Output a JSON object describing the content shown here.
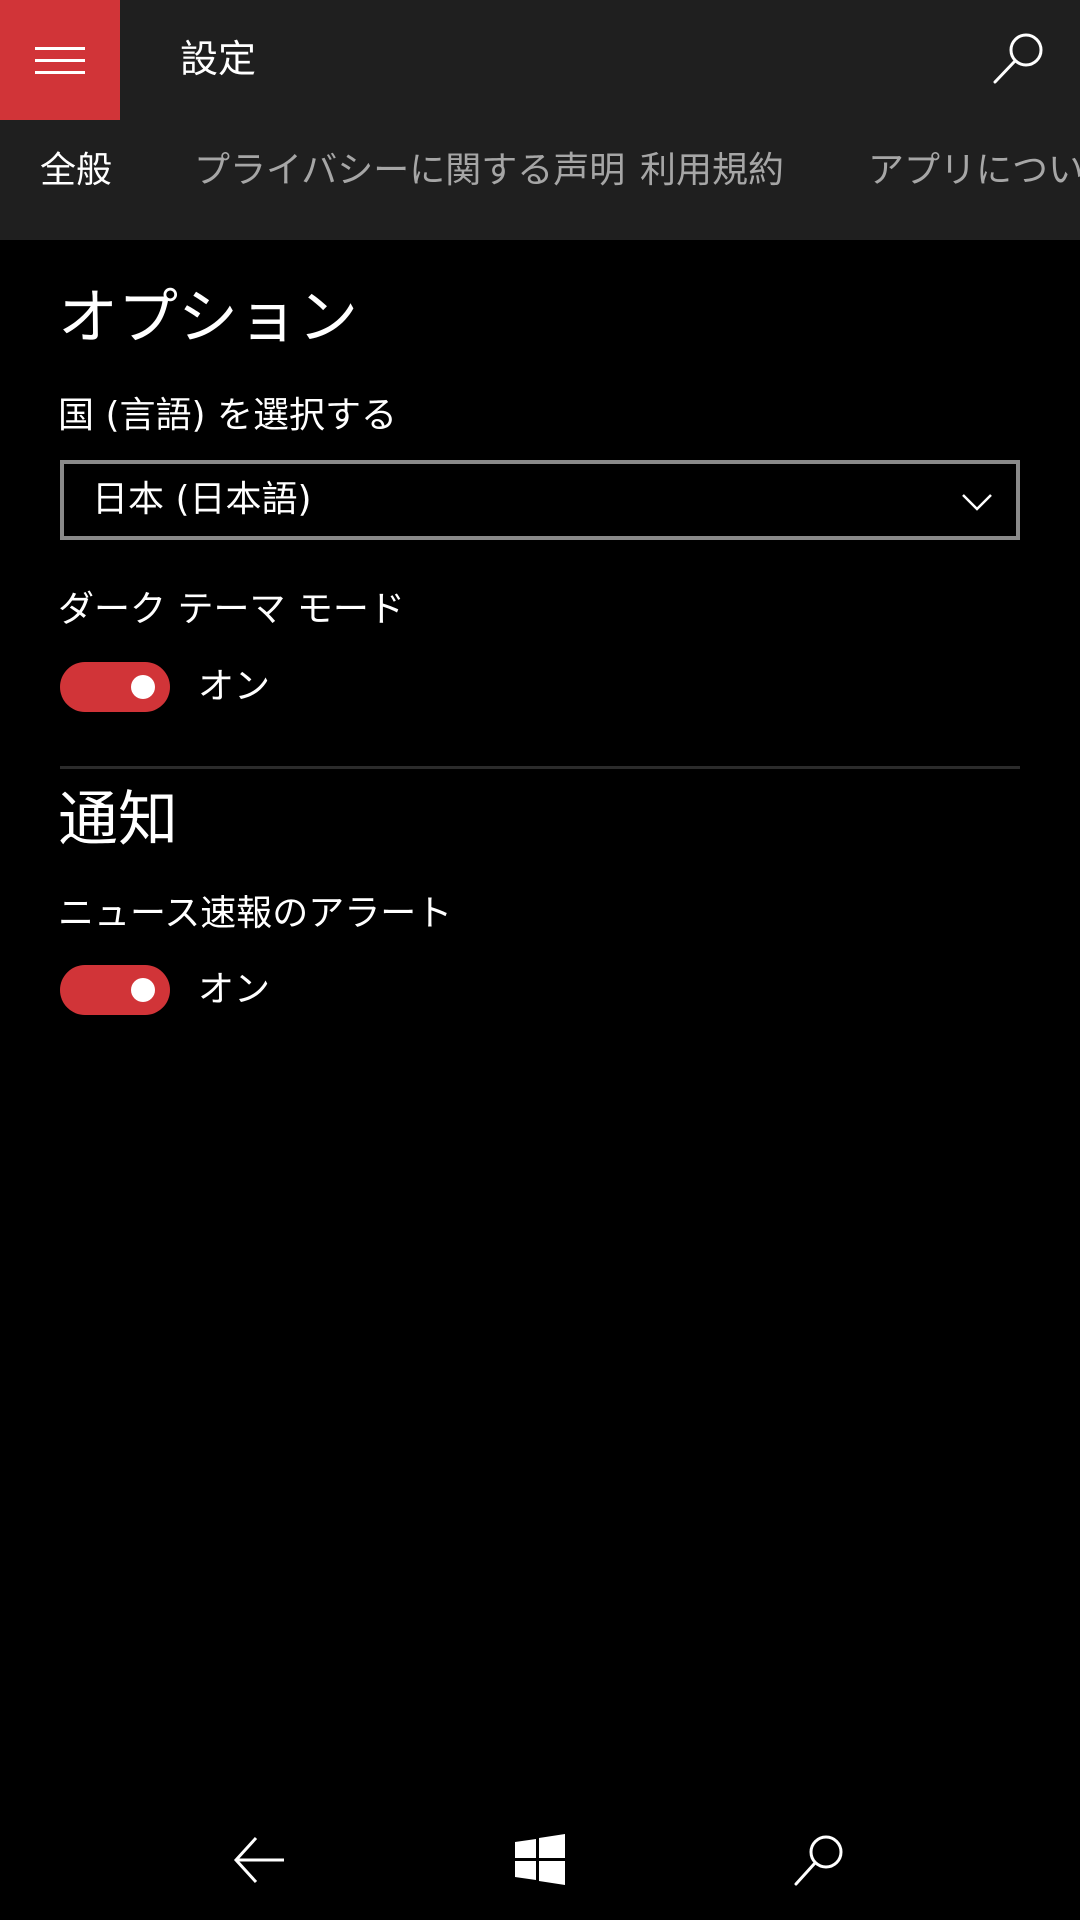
{
  "header": {
    "title": "設定",
    "menu_icon": "hamburger-menu-icon",
    "search_icon": "search-icon"
  },
  "tabs": [
    {
      "label": "全般",
      "active": true
    },
    {
      "label": "プライバシーに関する声明",
      "active": false
    },
    {
      "label": "利用規約",
      "active": false
    },
    {
      "label": "アプリについて",
      "active": false
    }
  ],
  "options": {
    "title": "オプション",
    "country_label": "国 (言語) を選択する",
    "country_value": "日本 (日本語)",
    "dark_theme_label": "ダーク テーマ モード",
    "dark_theme_state": "オン"
  },
  "notifications": {
    "title": "通知",
    "breaking_news_label": "ニュース速報のアラート",
    "breaking_news_state": "オン"
  },
  "navbar": {
    "back_icon": "back-arrow-icon",
    "home_icon": "windows-logo-icon",
    "search_icon": "search-icon"
  },
  "colors": {
    "accent": "#d13438",
    "header_bg": "#1f1f1f",
    "background": "#000000",
    "inactive_tab": "#a6a6a6"
  }
}
